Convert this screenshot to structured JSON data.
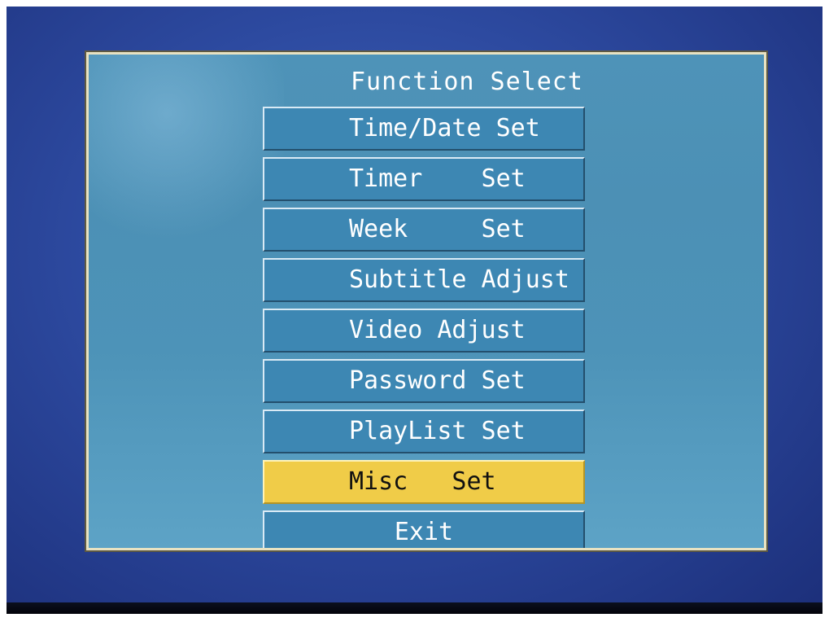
{
  "osd": {
    "title": "Function Select",
    "items": [
      {
        "label": "Time/Date Set",
        "selected": false
      },
      {
        "label": "Timer    Set",
        "selected": false
      },
      {
        "label": "Week     Set",
        "selected": false
      },
      {
        "label": "Subtitle Adjust",
        "selected": false
      },
      {
        "label": "Video Adjust",
        "selected": false
      },
      {
        "label": "Password Set",
        "selected": false
      },
      {
        "label": "PlayList Set",
        "selected": false
      },
      {
        "label": "Misc   Set",
        "selected": true
      },
      {
        "label": "Exit",
        "selected": false
      }
    ],
    "colors": {
      "panel": "#4e93b8",
      "item": "#3d87b3",
      "highlight": "#f0cc48",
      "text": "#ffffff",
      "frame": "#e8e2c2"
    }
  }
}
